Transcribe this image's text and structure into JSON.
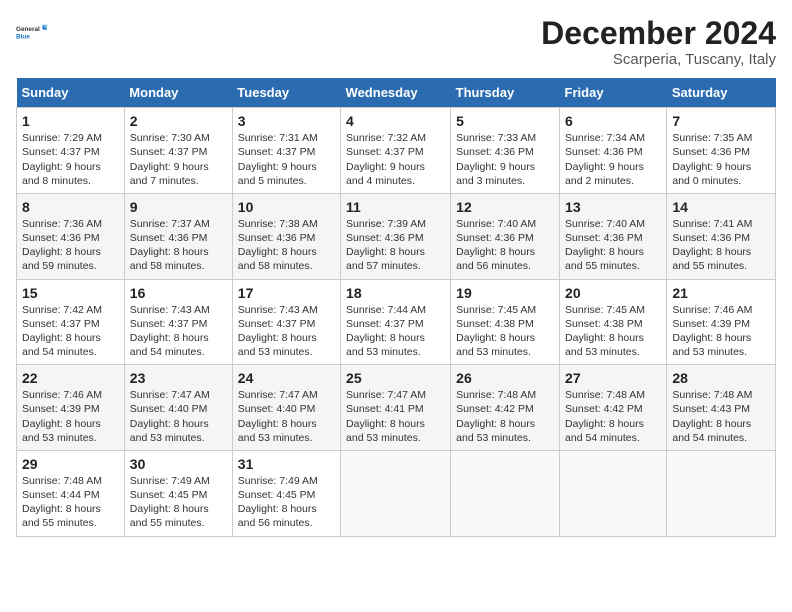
{
  "logo": {
    "line1": "General",
    "line2": "Blue"
  },
  "title": "December 2024",
  "subtitle": "Scarperia, Tuscany, Italy",
  "days_of_week": [
    "Sunday",
    "Monday",
    "Tuesday",
    "Wednesday",
    "Thursday",
    "Friday",
    "Saturday"
  ],
  "weeks": [
    [
      {
        "day": "1",
        "info": "Sunrise: 7:29 AM\nSunset: 4:37 PM\nDaylight: 9 hours\nand 8 minutes."
      },
      {
        "day": "2",
        "info": "Sunrise: 7:30 AM\nSunset: 4:37 PM\nDaylight: 9 hours\nand 7 minutes."
      },
      {
        "day": "3",
        "info": "Sunrise: 7:31 AM\nSunset: 4:37 PM\nDaylight: 9 hours\nand 5 minutes."
      },
      {
        "day": "4",
        "info": "Sunrise: 7:32 AM\nSunset: 4:37 PM\nDaylight: 9 hours\nand 4 minutes."
      },
      {
        "day": "5",
        "info": "Sunrise: 7:33 AM\nSunset: 4:36 PM\nDaylight: 9 hours\nand 3 minutes."
      },
      {
        "day": "6",
        "info": "Sunrise: 7:34 AM\nSunset: 4:36 PM\nDaylight: 9 hours\nand 2 minutes."
      },
      {
        "day": "7",
        "info": "Sunrise: 7:35 AM\nSunset: 4:36 PM\nDaylight: 9 hours\nand 0 minutes."
      }
    ],
    [
      {
        "day": "8",
        "info": "Sunrise: 7:36 AM\nSunset: 4:36 PM\nDaylight: 8 hours\nand 59 minutes."
      },
      {
        "day": "9",
        "info": "Sunrise: 7:37 AM\nSunset: 4:36 PM\nDaylight: 8 hours\nand 58 minutes."
      },
      {
        "day": "10",
        "info": "Sunrise: 7:38 AM\nSunset: 4:36 PM\nDaylight: 8 hours\nand 58 minutes."
      },
      {
        "day": "11",
        "info": "Sunrise: 7:39 AM\nSunset: 4:36 PM\nDaylight: 8 hours\nand 57 minutes."
      },
      {
        "day": "12",
        "info": "Sunrise: 7:40 AM\nSunset: 4:36 PM\nDaylight: 8 hours\nand 56 minutes."
      },
      {
        "day": "13",
        "info": "Sunrise: 7:40 AM\nSunset: 4:36 PM\nDaylight: 8 hours\nand 55 minutes."
      },
      {
        "day": "14",
        "info": "Sunrise: 7:41 AM\nSunset: 4:36 PM\nDaylight: 8 hours\nand 55 minutes."
      }
    ],
    [
      {
        "day": "15",
        "info": "Sunrise: 7:42 AM\nSunset: 4:37 PM\nDaylight: 8 hours\nand 54 minutes."
      },
      {
        "day": "16",
        "info": "Sunrise: 7:43 AM\nSunset: 4:37 PM\nDaylight: 8 hours\nand 54 minutes."
      },
      {
        "day": "17",
        "info": "Sunrise: 7:43 AM\nSunset: 4:37 PM\nDaylight: 8 hours\nand 53 minutes."
      },
      {
        "day": "18",
        "info": "Sunrise: 7:44 AM\nSunset: 4:37 PM\nDaylight: 8 hours\nand 53 minutes."
      },
      {
        "day": "19",
        "info": "Sunrise: 7:45 AM\nSunset: 4:38 PM\nDaylight: 8 hours\nand 53 minutes."
      },
      {
        "day": "20",
        "info": "Sunrise: 7:45 AM\nSunset: 4:38 PM\nDaylight: 8 hours\nand 53 minutes."
      },
      {
        "day": "21",
        "info": "Sunrise: 7:46 AM\nSunset: 4:39 PM\nDaylight: 8 hours\nand 53 minutes."
      }
    ],
    [
      {
        "day": "22",
        "info": "Sunrise: 7:46 AM\nSunset: 4:39 PM\nDaylight: 8 hours\nand 53 minutes."
      },
      {
        "day": "23",
        "info": "Sunrise: 7:47 AM\nSunset: 4:40 PM\nDaylight: 8 hours\nand 53 minutes."
      },
      {
        "day": "24",
        "info": "Sunrise: 7:47 AM\nSunset: 4:40 PM\nDaylight: 8 hours\nand 53 minutes."
      },
      {
        "day": "25",
        "info": "Sunrise: 7:47 AM\nSunset: 4:41 PM\nDaylight: 8 hours\nand 53 minutes."
      },
      {
        "day": "26",
        "info": "Sunrise: 7:48 AM\nSunset: 4:42 PM\nDaylight: 8 hours\nand 53 minutes."
      },
      {
        "day": "27",
        "info": "Sunrise: 7:48 AM\nSunset: 4:42 PM\nDaylight: 8 hours\nand 54 minutes."
      },
      {
        "day": "28",
        "info": "Sunrise: 7:48 AM\nSunset: 4:43 PM\nDaylight: 8 hours\nand 54 minutes."
      }
    ],
    [
      {
        "day": "29",
        "info": "Sunrise: 7:48 AM\nSunset: 4:44 PM\nDaylight: 8 hours\nand 55 minutes."
      },
      {
        "day": "30",
        "info": "Sunrise: 7:49 AM\nSunset: 4:45 PM\nDaylight: 8 hours\nand 55 minutes."
      },
      {
        "day": "31",
        "info": "Sunrise: 7:49 AM\nSunset: 4:45 PM\nDaylight: 8 hours\nand 56 minutes."
      },
      {
        "day": "",
        "info": ""
      },
      {
        "day": "",
        "info": ""
      },
      {
        "day": "",
        "info": ""
      },
      {
        "day": "",
        "info": ""
      }
    ]
  ]
}
